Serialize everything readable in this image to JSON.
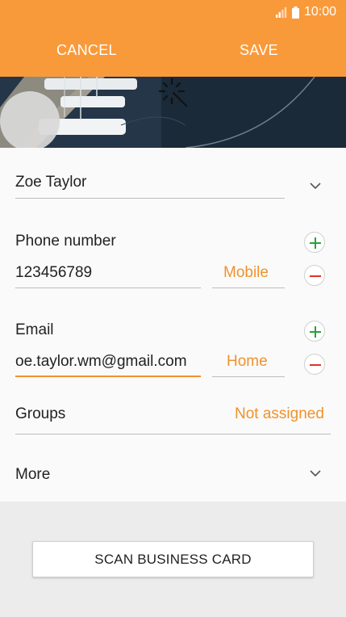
{
  "status_bar": {
    "time": "10:00",
    "signal_icon": "signal-icon",
    "battery_icon": "battery-icon"
  },
  "header": {
    "cancel_label": "CANCEL",
    "save_label": "SAVE",
    "bg_color": "#f99a3a"
  },
  "photo": {
    "icon": "magic-wand-icon"
  },
  "name": {
    "value": "Zoe Taylor",
    "expand_icon": "chevron-down-icon"
  },
  "phone": {
    "label": "Phone number",
    "value": "123456789",
    "type": "Mobile",
    "add_icon": "plus-icon",
    "remove_icon": "minus-icon"
  },
  "email": {
    "label": "Email",
    "value": "oe.taylor.wm@gmail.com",
    "type": "Home",
    "add_icon": "plus-icon",
    "remove_icon": "minus-icon"
  },
  "groups": {
    "label": "Groups",
    "value": "Not assigned"
  },
  "more": {
    "label": "More",
    "expand_icon": "chevron-down-icon"
  },
  "scan_button": {
    "label": "SCAN BUSINESS CARD"
  },
  "colors": {
    "accent": "#f0922c",
    "add": "#2aa13b",
    "remove": "#e0322b"
  }
}
